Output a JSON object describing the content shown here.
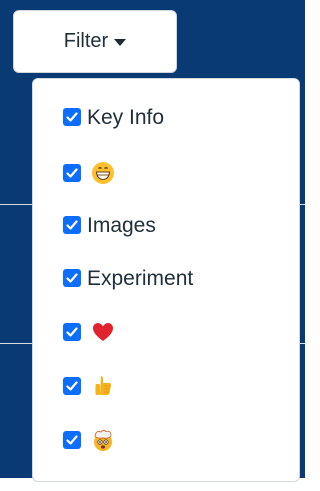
{
  "filter_button": {
    "label": "Filter"
  },
  "dropdown": {
    "items": [
      {
        "label": "Key Info",
        "checked": true,
        "icon": ""
      },
      {
        "label": "",
        "checked": true,
        "icon": "grinning-face-emoji"
      },
      {
        "label": "Images",
        "checked": true,
        "icon": ""
      },
      {
        "label": "Experiment",
        "checked": true,
        "icon": ""
      },
      {
        "label": "",
        "checked": true,
        "icon": "red-heart-emoji"
      },
      {
        "label": "",
        "checked": true,
        "icon": "thumbs-up-emoji"
      },
      {
        "label": "",
        "checked": true,
        "icon": "exploding-head-emoji"
      }
    ]
  },
  "colors": {
    "background": "#0a3a73",
    "checkbox": "#0d6efd",
    "text": "#22303b"
  }
}
